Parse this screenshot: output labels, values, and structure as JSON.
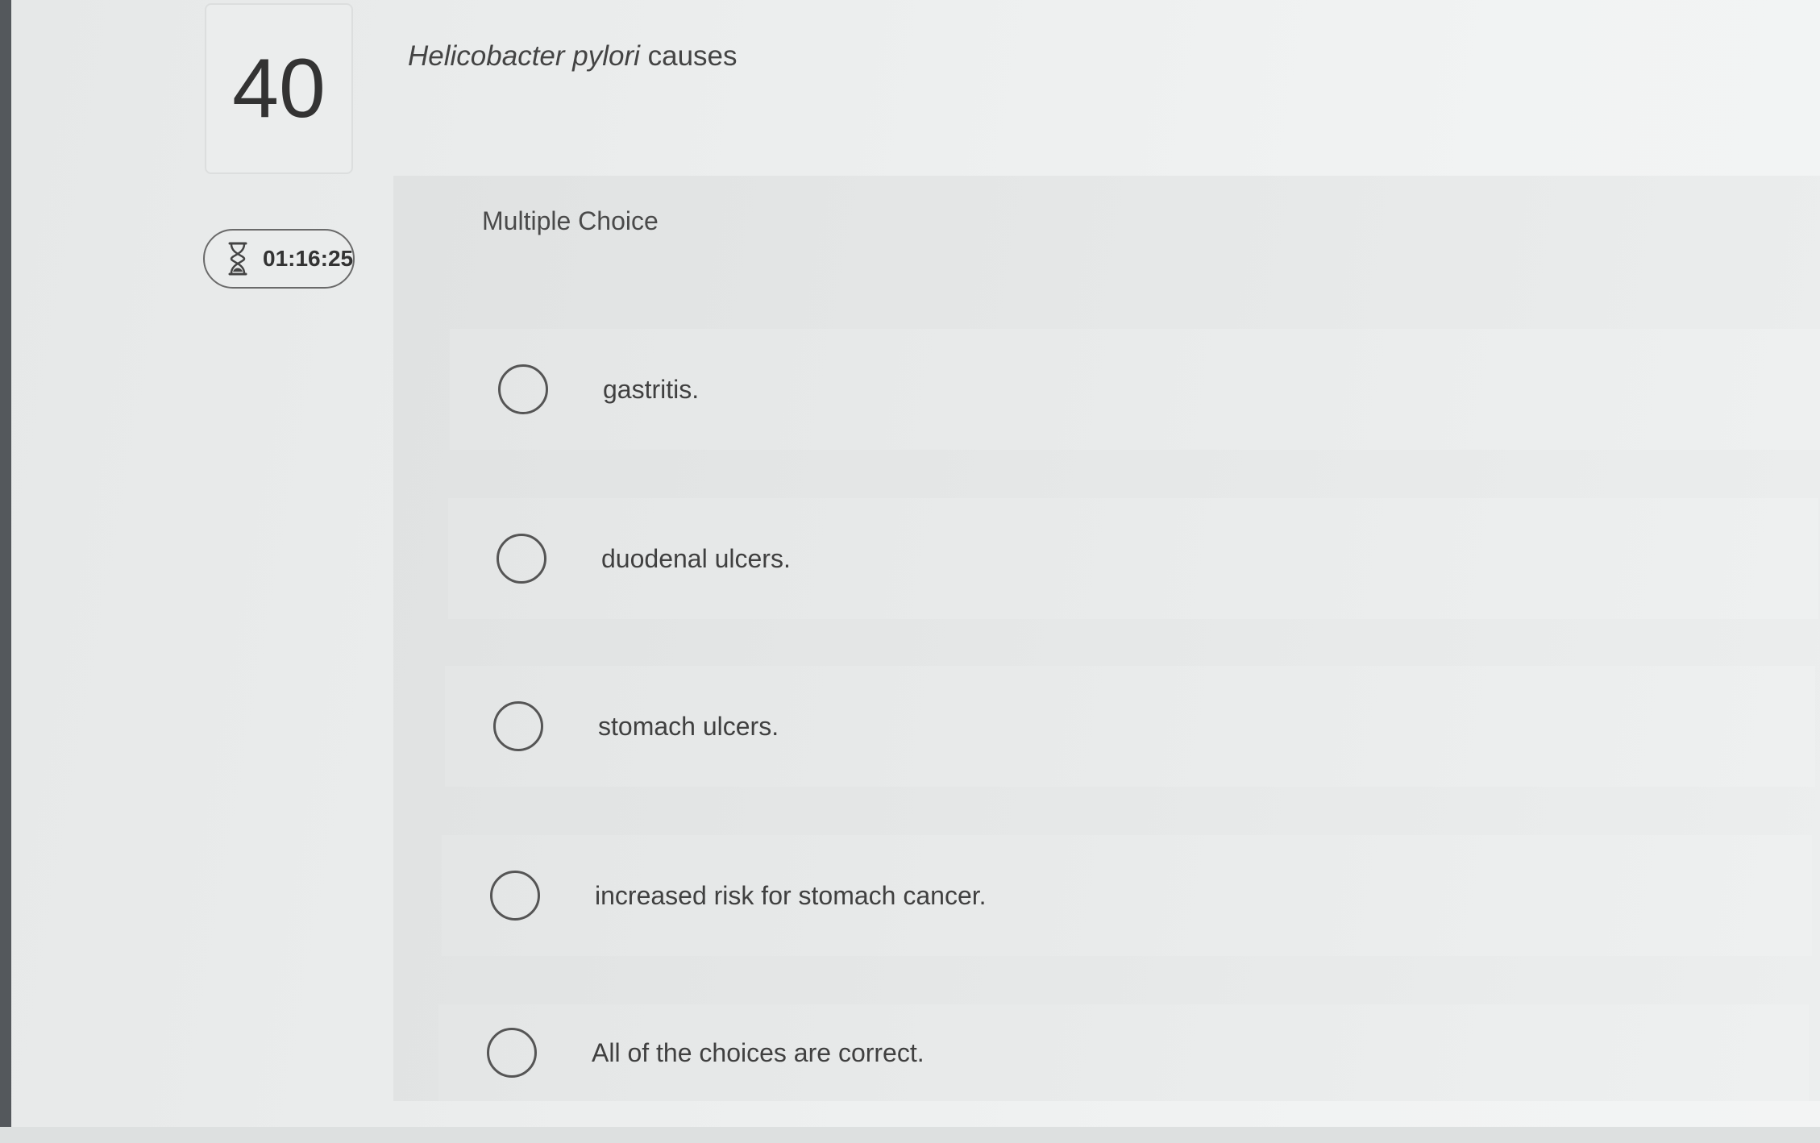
{
  "question": {
    "number": "40",
    "timer": "01:16:25",
    "text_italic": "Helicobacter pylori",
    "text_rest": " causes",
    "type_label": "Multiple Choice",
    "options": [
      {
        "label": "gastritis."
      },
      {
        "label": "duodenal ulcers."
      },
      {
        "label": "stomach ulcers."
      },
      {
        "label": "increased risk for stomach cancer."
      },
      {
        "label": "All of the choices are correct."
      }
    ]
  },
  "icons": {
    "timer": "hourglass-icon",
    "option_control": "radio-circle"
  }
}
